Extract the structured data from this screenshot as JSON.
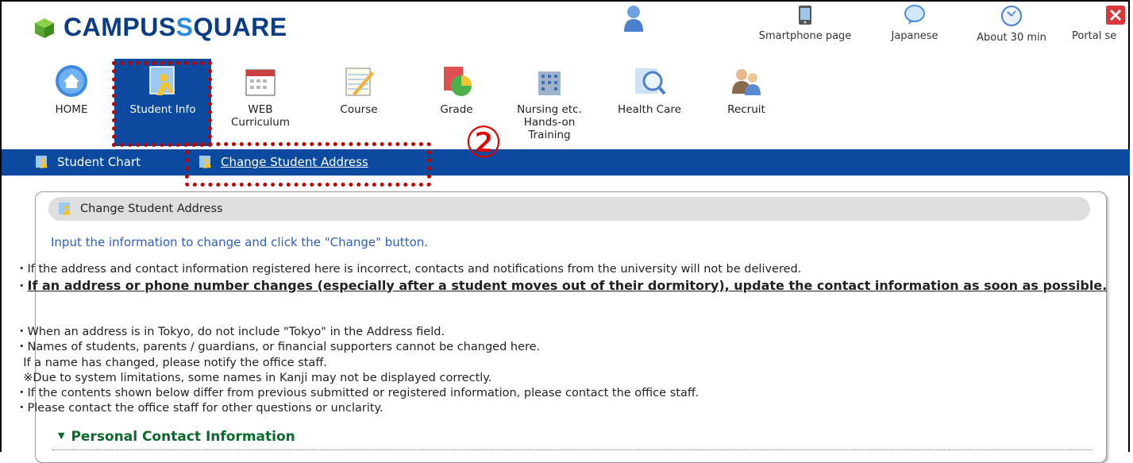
{
  "logo": {
    "part1": "CAMPUS",
    "part2": "S",
    "part3": "QUARE"
  },
  "utility": [
    {
      "label": "Smartphone page",
      "icon": "smartphone-icon"
    },
    {
      "label": "Japanese",
      "icon": "speech-bubble-icon"
    },
    {
      "label": "About 30 min",
      "icon": "clock-icon"
    },
    {
      "label": "Portal se",
      "icon": "close-portal-icon"
    }
  ],
  "nav": [
    {
      "label": "HOME",
      "icon": "home-icon"
    },
    {
      "label": "Student Info",
      "icon": "student-info-icon"
    },
    {
      "label": "WEB Curriculum",
      "icon": "calendar-icon"
    },
    {
      "label": "Course",
      "icon": "notepad-icon"
    },
    {
      "label": "Grade",
      "icon": "pie-chart-icon"
    },
    {
      "label": "Nursing etc. Hands-on Training",
      "icon": "building-icon"
    },
    {
      "label": "Health Care",
      "icon": "magnifier-icon"
    },
    {
      "label": "Recruit",
      "icon": "people-icon"
    }
  ],
  "subnav": [
    {
      "label": "Student Chart"
    },
    {
      "label": "Change Student Address"
    }
  ],
  "callout": "②",
  "panel": {
    "title": "Change Student Address",
    "lead": "Input the information to change and click the \"Change\" button.",
    "note1": "・If the address and contact information registered here is incorrect, contacts and notifications from the university will not be delivered.",
    "note2_prefix": "・",
    "note2": "If an address or phone number changes (especially after a student moves out of their dormitory), update the contact information as soon as possible.",
    "list": [
      "・When an address is in Tokyo, do not include \"Tokyo\" in the Address field.",
      "・Names of students, parents / guardians, or financial supporters cannot be changed here.",
      "  If a name has changed, please notify the office staff.",
      "  ※Due to system limitations, some names in Kanji may not be displayed correctly.",
      "・If the contents shown below differ from previous submitted or registered information, please contact the office staff.",
      "・Please contact the office staff for other questions or unclarity."
    ],
    "section": "Personal Contact Information"
  },
  "colors": {
    "brand": "#0b4a9e",
    "annotation": "#c00000",
    "section": "#0a6a2a",
    "lead": "#2c5fc0"
  }
}
